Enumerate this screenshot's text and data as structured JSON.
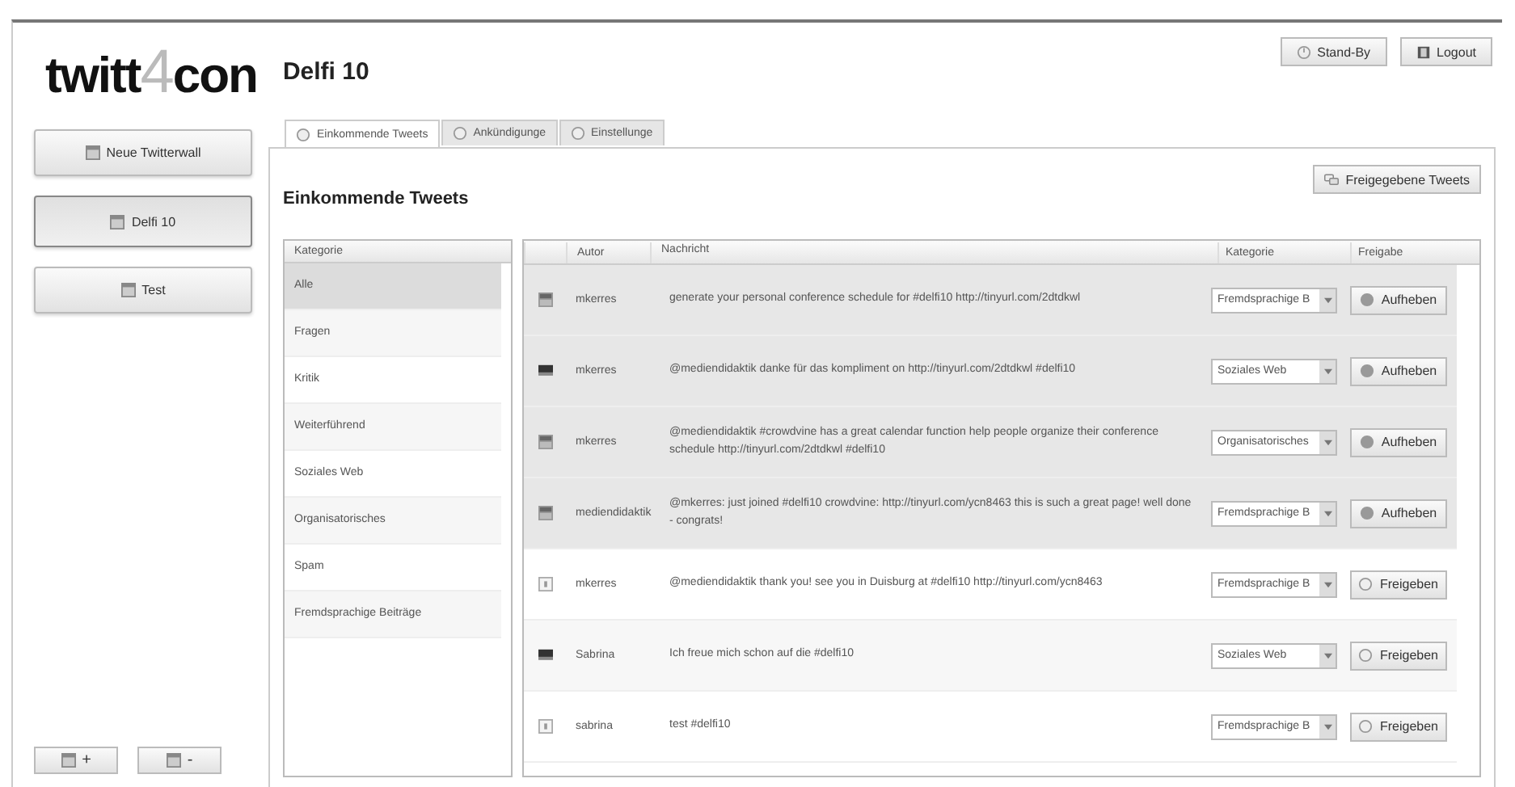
{
  "logo": {
    "parts": [
      "twitt",
      "4",
      "con"
    ]
  },
  "title": "Delfi 10",
  "top_buttons": [
    {
      "label": "Stand-By"
    },
    {
      "label": "Logout"
    }
  ],
  "sidebar": {
    "items": [
      {
        "label": "Neue Twitterwall",
        "selected": false
      },
      {
        "label": "Delfi 10",
        "selected": true
      },
      {
        "label": "Test",
        "selected": false
      }
    ],
    "footer_buttons": [
      "+",
      "-"
    ]
  },
  "tabs": [
    {
      "label": "Einkommende Tweets",
      "selected": true
    },
    {
      "label": "Ankündigunge",
      "selected": false
    },
    {
      "label": "Einstellunge",
      "selected": false
    }
  ],
  "panel": {
    "heading": "Einkommende Tweets",
    "action_button": "Freigegebene Tweets"
  },
  "categories": {
    "header": "Kategorie",
    "items": [
      {
        "label": "Alle",
        "selected": true
      },
      {
        "label": "Fragen",
        "selected": false
      },
      {
        "label": "Kritik",
        "selected": false
      },
      {
        "label": "Weiterführend",
        "selected": false
      },
      {
        "label": "Soziales Web",
        "selected": false
      },
      {
        "label": "Organisatorisches",
        "selected": false
      },
      {
        "label": "Spam",
        "selected": false
      },
      {
        "label": "Fremdsprachige Beiträge",
        "selected": false
      }
    ]
  },
  "table": {
    "columns": [
      "Autor",
      "Nachricht",
      "Kategorie",
      "Freigabe"
    ],
    "rows": [
      {
        "kind": "image",
        "author": "mkerres",
        "message": "generate your personal conference schedule for #delfi10 http://tinyurl.com/2dtdkwl",
        "category": "Fremdsprachige B",
        "approved": true,
        "action": "Aufheben"
      },
      {
        "kind": "dark",
        "author": "mkerres",
        "message": "@mediendidaktik danke für das kompliment on http://tinyurl.com/2dtdkwl #delfi10",
        "category": "Soziales Web",
        "approved": true,
        "action": "Aufheben"
      },
      {
        "kind": "image",
        "author": "mkerres",
        "message": "@mediendidaktik #crowdvine has a great calendar function help people organize their conference schedule http://tinyurl.com/2dtdkwl #delfi10",
        "category": "Organisatorisches",
        "approved": true,
        "action": "Aufheben"
      },
      {
        "kind": "image",
        "author": "mediendidaktik",
        "message": "@mkerres: just joined #delfi10 crowdvine: http://tinyurl.com/ycn8463 this is such a great page! well done - congrats!",
        "category": "Fremdsprachige B",
        "approved": true,
        "action": "Aufheben"
      },
      {
        "kind": "default",
        "author": "mkerres",
        "message": "@mediendidaktik thank you! see you in Duisburg at #delfi10 http://tinyurl.com/ycn8463",
        "category": "Fremdsprachige B",
        "approved": false,
        "action": "Freigeben"
      },
      {
        "kind": "dark",
        "author": "Sabrina",
        "message": "Ich freue mich schon auf die #delfi10",
        "category": "Soziales Web",
        "approved": false,
        "action": "Freigeben"
      },
      {
        "kind": "default",
        "author": "sabrina",
        "message": "test #delfi10",
        "category": "Fremdsprachige B",
        "approved": false,
        "action": "Freigeben"
      }
    ]
  }
}
